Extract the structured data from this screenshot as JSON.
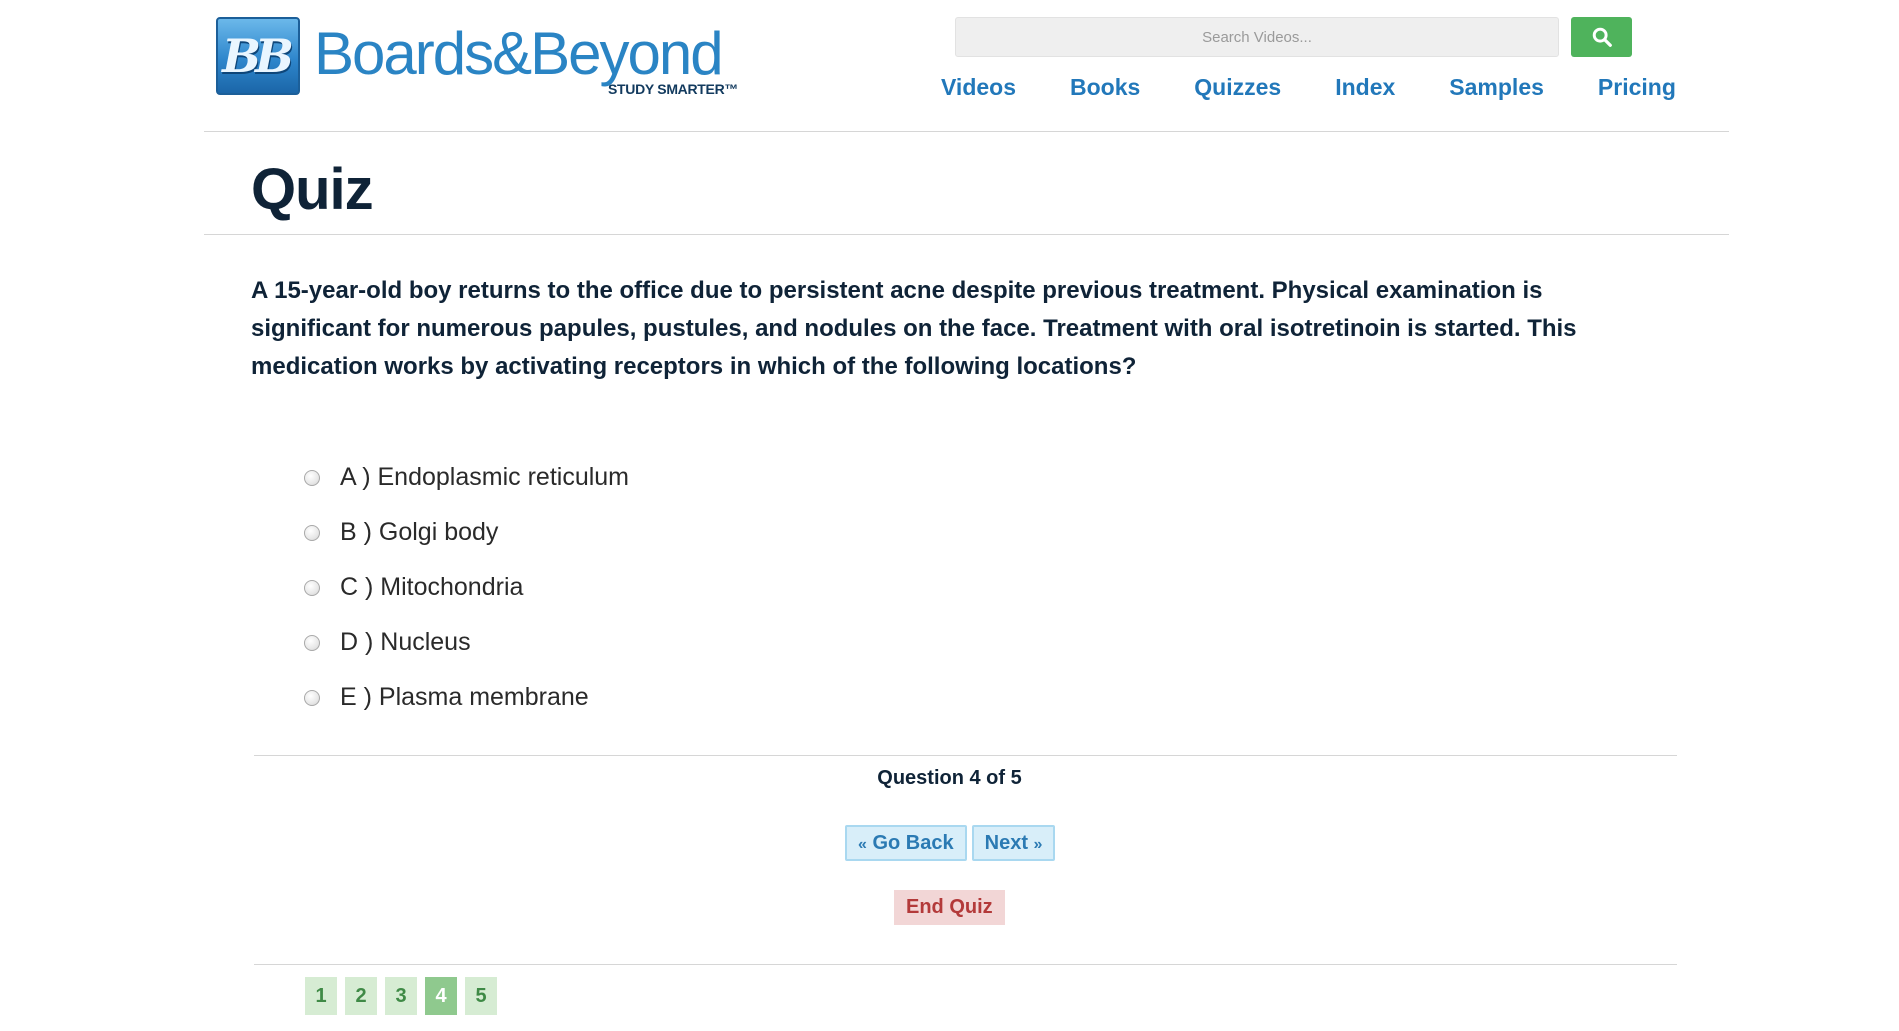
{
  "header": {
    "logo": {
      "badge": "BB",
      "wordmark": "Boards&Beyond",
      "tagline": "STUDY SMARTER™"
    },
    "search": {
      "placeholder": "Search Videos...",
      "icon": "search-icon"
    },
    "nav": [
      "Videos",
      "Books",
      "Quizzes",
      "Index",
      "Samples",
      "Pricing"
    ]
  },
  "page": {
    "title": "Quiz"
  },
  "quiz": {
    "question": "A 15-year-old boy returns to the office due to persistent acne despite previous treatment. Physical examination is significant for numerous papules, pustules, and nodules on the face. Treatment with oral isotretinoin is started. This medication works by activating receptors in which of the following locations?",
    "options": [
      "A ) Endoplasmic reticulum",
      "B ) Golgi body",
      "C ) Mitochondria",
      "D ) Nucleus",
      "E ) Plasma membrane"
    ],
    "progress": "Question 4 of 5",
    "buttons": {
      "back": "Go Back",
      "next": "Next",
      "end": "End Quiz"
    },
    "pages": [
      "1",
      "2",
      "3",
      "4",
      "5"
    ],
    "current_page": "4"
  },
  "colors": {
    "nav_link": "#2278ba",
    "search_button": "#4fb35c",
    "heading": "#0f2337",
    "end_button_text": "#b33a3a",
    "pager_active": "#8fc98e"
  }
}
